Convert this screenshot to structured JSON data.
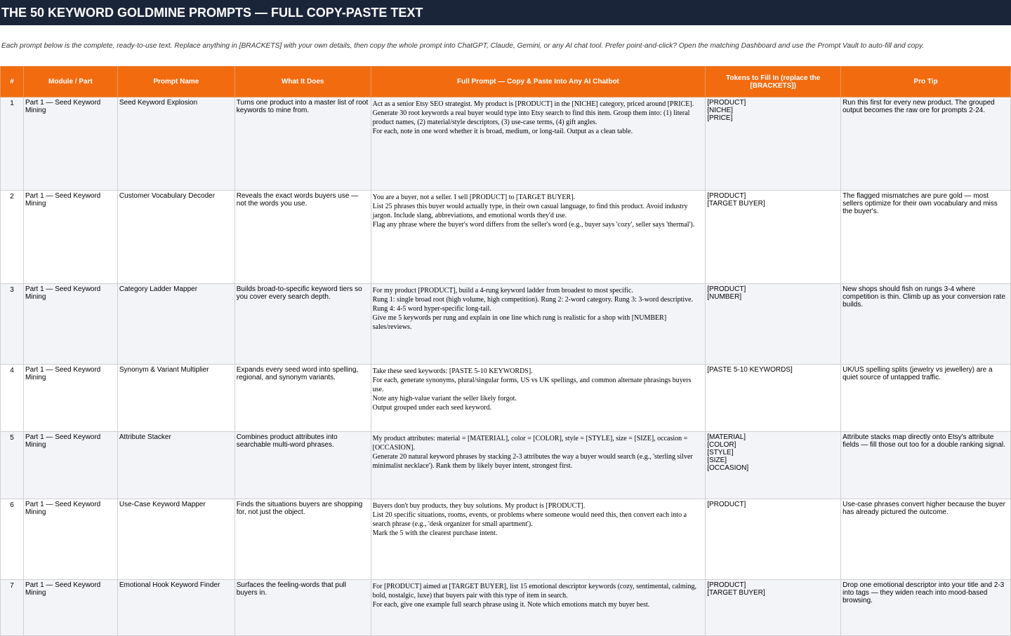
{
  "title": "THE 50 KEYWORD GOLDMINE PROMPTS — FULL COPY-PASTE TEXT",
  "intro": "Each prompt below is the complete, ready-to-use text. Replace anything in [BRACKETS] with your own details, then copy the whole prompt into ChatGPT, Claude, Gemini, or any AI chat tool. Prefer point-and-click? Open the matching Dashboard and use the Prompt Vault to auto-fill and copy.",
  "colors": {
    "title_bg": "#1b253a",
    "header_bg": "#f26b0f",
    "odd_row": "#f3f4f8"
  },
  "headers": [
    "#",
    "Module / Part",
    "Prompt Name",
    "What It Does",
    "Full Prompt — Copy & Paste Into Any AI Chatbot",
    "Tokens to Fill In (replace the [BRACKETS])",
    "Pro Tip"
  ],
  "rows": [
    {
      "num": "1",
      "module": "Part 1 — Seed Keyword Mining",
      "name": "Seed Keyword Explosion",
      "does": "Turns one product into a master list of root keywords to mine from.",
      "prompt": [
        "Act as a senior Etsy SEO strategist. My product is [PRODUCT] in the [NICHE] category, priced around [PRICE].",
        "Generate 30 root keywords a real buyer would type into Etsy search to find this item. Group them into: (1) literal product names, (2) material/style descriptors, (3) use-case terms, (4) gift angles.",
        "For each, note in one word whether it is broad, medium, or long-tail. Output as a clean table."
      ],
      "tokens": "[PRODUCT]\n[NICHE]\n[PRICE]",
      "tip": "Run this first for every new product. The grouped output becomes the raw ore for prompts 2-24."
    },
    {
      "num": "2",
      "module": "Part 1 — Seed Keyword Mining",
      "name": "Customer Vocabulary Decoder",
      "does": "Reveals the exact words buyers use — not the words you use.",
      "prompt": [
        "You are a buyer, not a seller. I sell [PRODUCT] to [TARGET BUYER].",
        "List 25 phrases this buyer would actually type, in their own casual language, to find this product. Avoid industry jargon. Include slang, abbreviations, and emotional words they'd use.",
        "Flag any phrase where the buyer's word differs from the seller's word (e.g., buyer says 'cozy', seller says 'thermal')."
      ],
      "tokens": "[PRODUCT]\n[TARGET BUYER]",
      "tip": "The flagged mismatches are pure gold — most sellers optimize for their own vocabulary and miss the buyer's."
    },
    {
      "num": "3",
      "module": "Part 1 — Seed Keyword Mining",
      "name": "Category Ladder Mapper",
      "does": "Builds broad-to-specific keyword tiers so you cover every search depth.",
      "prompt": [
        "For my product [PRODUCT], build a 4-rung keyword ladder from broadest to most specific.",
        "Rung 1: single broad root (high volume, high competition). Rung 2: 2-word category. Rung 3: 3-word descriptive.",
        "Rung 4: 4-5 word hyper-specific long-tail.",
        "Give me 5 keywords per rung and explain in one line which rung is realistic for a shop with [NUMBER] sales/reviews."
      ],
      "tokens": "[PRODUCT]\n[NUMBER]",
      "tip": "New shops should fish on rungs 3-4 where competition is thin. Climb up as your conversion rate builds."
    },
    {
      "num": "4",
      "module": "Part 1 — Seed Keyword Mining",
      "name": "Synonym & Variant Multiplier",
      "does": "Expands every seed word into spelling, regional, and synonym variants.",
      "prompt": [
        "Take these seed keywords: [PASTE 5-10 KEYWORDS].",
        "For each, generate synonyms, plural/singular forms, US vs UK spellings, and common alternate phrasings buyers use.",
        "Note any high-value variant the seller likely forgot.",
        "Output grouped under each seed keyword."
      ],
      "tokens": "[PASTE 5-10 KEYWORDS]",
      "tip": "UK/US spelling splits (jewelry vs jewellery) are a quiet source of untapped traffic."
    },
    {
      "num": "5",
      "module": "Part 1 — Seed Keyword Mining",
      "name": "Attribute Stacker",
      "does": "Combines product attributes into searchable multi-word phrases.",
      "prompt": [
        "My product attributes: material = [MATERIAL], color = [COLOR], style = [STYLE], size = [SIZE], occasion = [OCCASION].",
        "Generate 20 natural keyword phrases by stacking 2-3 attributes the way a buyer would search (e.g., 'sterling silver minimalist necklace'). Rank them by likely buyer intent, strongest first."
      ],
      "tokens": "[MATERIAL]\n[COLOR]\n[STYLE]\n[SIZE]\n[OCCASION]",
      "tip": "Attribute stacks map directly onto Etsy's attribute fields — fill those out too for a double ranking signal."
    },
    {
      "num": "6",
      "module": "Part 1 — Seed Keyword Mining",
      "name": "Use-Case Keyword Mapper",
      "does": "Finds the situations buyers are shopping for, not just the object.",
      "prompt": [
        "Buyers don't buy products, they buy solutions. My product is [PRODUCT].",
        "List 20 specific situations, rooms, events, or problems where someone would need this, then convert each into a search phrase (e.g., 'desk organizer for small apartment').",
        "Mark the 5 with the clearest purchase intent."
      ],
      "tokens": "[PRODUCT]",
      "tip": "Use-case phrases convert higher because the buyer has already pictured the outcome."
    },
    {
      "num": "7",
      "module": "Part 1 — Seed Keyword Mining",
      "name": "Emotional Hook Keyword Finder",
      "does": "Surfaces the feeling-words that pull buyers in.",
      "prompt": [
        "For [PRODUCT] aimed at [TARGET BUYER], list 15 emotional descriptor keywords (cozy, sentimental, calming, bold, nostalgic, luxe) that buyers pair with this type of item in search.",
        "For each, give one example full search phrase using it. Note which emotions match my buyer best."
      ],
      "tokens": "[PRODUCT]\n[TARGET BUYER]",
      "tip": "Drop one emotional descriptor into your title and 2-3 into tags — they widen reach into mood-based browsing."
    }
  ]
}
